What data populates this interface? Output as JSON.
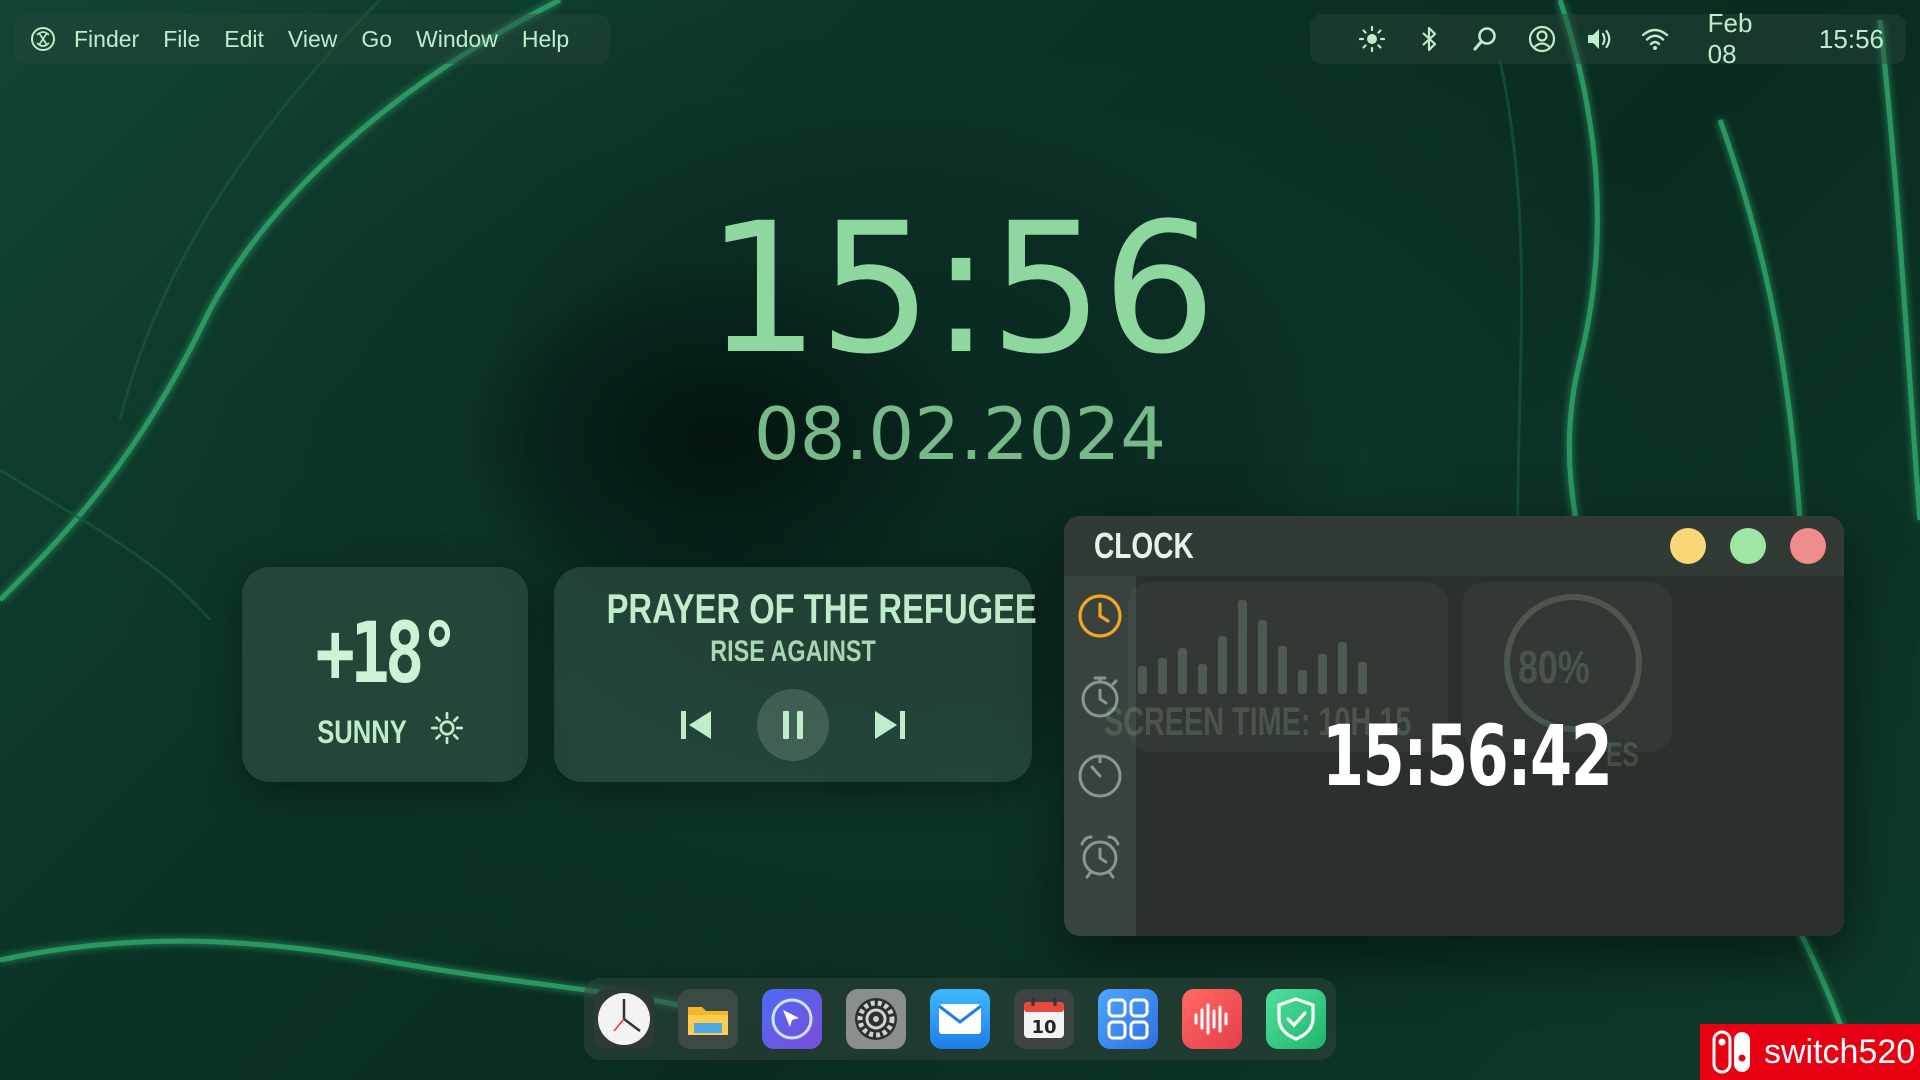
{
  "menubar": {
    "items": [
      "Finder",
      "File",
      "Edit",
      "View",
      "Go",
      "Window",
      "Help"
    ],
    "date": "Feb 08",
    "time": "15:56",
    "status_icons": [
      "brightness-icon",
      "bluetooth-icon",
      "search-icon",
      "user-icon",
      "volume-icon",
      "wifi-icon"
    ]
  },
  "desktop_clock": {
    "time": "15:56",
    "date": "08.02.2024"
  },
  "weather": {
    "temperature": "+18°",
    "condition": "SUNNY"
  },
  "music": {
    "song": "PRAYER OF THE REFUGEE",
    "artist": "RISE AGAINST"
  },
  "clock_window": {
    "title": "CLOCK",
    "time": "15:56:42",
    "background_text": "SCREEN TIME: 10H 15",
    "background_percent": "80%",
    "background_suffix": "ES",
    "sidebar": [
      "clock-icon",
      "timer-icon",
      "stopwatch-icon",
      "alarm-icon"
    ]
  },
  "dock": {
    "apps": [
      "clock-app-icon",
      "files-app-icon",
      "browser-app-icon",
      "settings-app-icon",
      "mail-app-icon",
      "calendar-app-icon",
      "apps-grid-icon",
      "voice-memos-icon",
      "security-app-icon"
    ],
    "calendar_day": "10"
  },
  "watermark": {
    "text": "switch520"
  },
  "colors": {
    "accent_green": "#8ed8a0",
    "active_orange": "#f5a623",
    "traffic_yellow": "#f7d774",
    "traffic_green": "#9ee6a3",
    "traffic_red": "#f28b8b"
  }
}
